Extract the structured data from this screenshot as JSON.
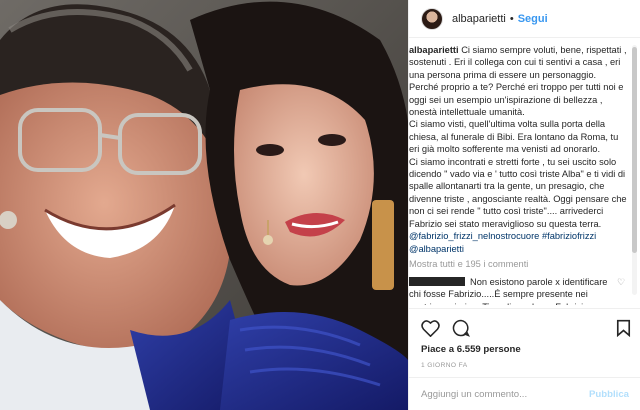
{
  "header": {
    "username": "albaparietti",
    "separator": "•",
    "follow_label": "Segui"
  },
  "caption": {
    "username": "albaparietti",
    "text": " Ci siamo sempre voluti, bene, rispettati , sostenuti . Eri il collega con cui ti sentivi a casa , eri una persona prima di essere un personaggio. Perché proprio a te? Perché eri troppo per tutti noi e oggi sei un esempio un'ispirazione di bellezza , onestà intellettuale umanità.\nCi siamo visti, quell'ultima volta sulla porta della chiesa, al funerale di Bibi. Era lontano da Roma, tu eri già molto sofferente ma venisti ad onorarlo.\nCi siamo incontrati e stretti forte , tu sei uscito solo dicendo \" vado via e ' tutto così triste Alba\" e ti vidi di spalle allontanarti tra la gente, un presagio, che divenne triste , angosciante realtà. Oggi pensare che non ci sei rende \" tutto così triste\".... arrivederci Fabrizio sei stato meraviglioso su questa terra.\n",
    "tags_line": "@fabrizio_frizzi_nelnostrocuore #fabriziofrizzi",
    "mention": "@albaparietti"
  },
  "load_more": "Mostra tutti e 195 i commenti",
  "comment": {
    "text": "Non esistono parole x identificare chi fosse Fabrizio.....É sempre presente nei nostri pensieri .... Ti vogliamo bene Fabrizio"
  },
  "actions": {
    "icons": [
      "heart-icon",
      "comment-icon",
      "bookmark-icon"
    ],
    "likes": "Piace a 6.559 persone",
    "date": "1 GIORNO FA"
  },
  "add_comment": {
    "placeholder": "Aggiungi un commento...",
    "publish_label": "Pubblica"
  }
}
